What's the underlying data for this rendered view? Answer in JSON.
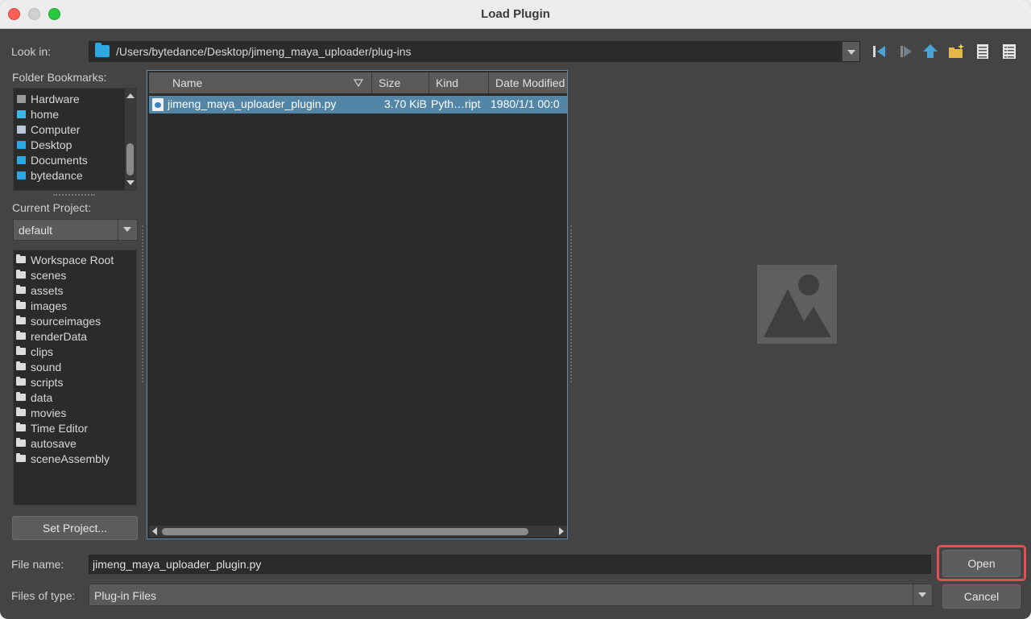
{
  "window": {
    "title": "Load Plugin"
  },
  "look_in": {
    "label": "Look in:",
    "path": "/Users/bytedance/Desktop/jimeng_maya_uploader/plug-ins"
  },
  "toolbar": {
    "icons": [
      "back-icon",
      "forward-icon",
      "parent-folder-icon",
      "new-folder-icon",
      "list-view-icon",
      "detail-view-icon"
    ]
  },
  "bookmarks": {
    "label": "Folder Bookmarks:",
    "items": [
      {
        "label": "Hardware",
        "icon": "hardware-icon"
      },
      {
        "label": "home",
        "icon": "home-icon"
      },
      {
        "label": "Computer",
        "icon": "computer-icon"
      },
      {
        "label": "Desktop",
        "icon": "folder-icon"
      },
      {
        "label": "Documents",
        "icon": "folder-icon"
      },
      {
        "label": "bytedance",
        "icon": "folder-icon"
      }
    ]
  },
  "project": {
    "label": "Current Project:",
    "value": "default",
    "folders": [
      "Workspace Root",
      "scenes",
      "assets",
      "images",
      "sourceimages",
      "renderData",
      "clips",
      "sound",
      "scripts",
      "data",
      "movies",
      "Time Editor",
      "autosave",
      "sceneAssembly"
    ],
    "set_button": "Set Project..."
  },
  "files": {
    "columns": [
      "Name",
      "Size",
      "Kind",
      "Date Modified"
    ],
    "rows": [
      {
        "name": "jimeng_maya_uploader_plugin.py",
        "size": "3.70 KiB",
        "kind": "Pyth…ript",
        "date": "1980/1/1 00:0"
      }
    ]
  },
  "file_name": {
    "label": "File name:",
    "value": "jimeng_maya_uploader_plugin.py"
  },
  "file_type": {
    "label": "Files of type:",
    "value": "Plug-in Files"
  },
  "buttons": {
    "open": "Open",
    "cancel": "Cancel"
  },
  "colors": {
    "selection": "#5285a6",
    "highlight": "#e05252",
    "folder_blue": "#2ea8e5"
  }
}
